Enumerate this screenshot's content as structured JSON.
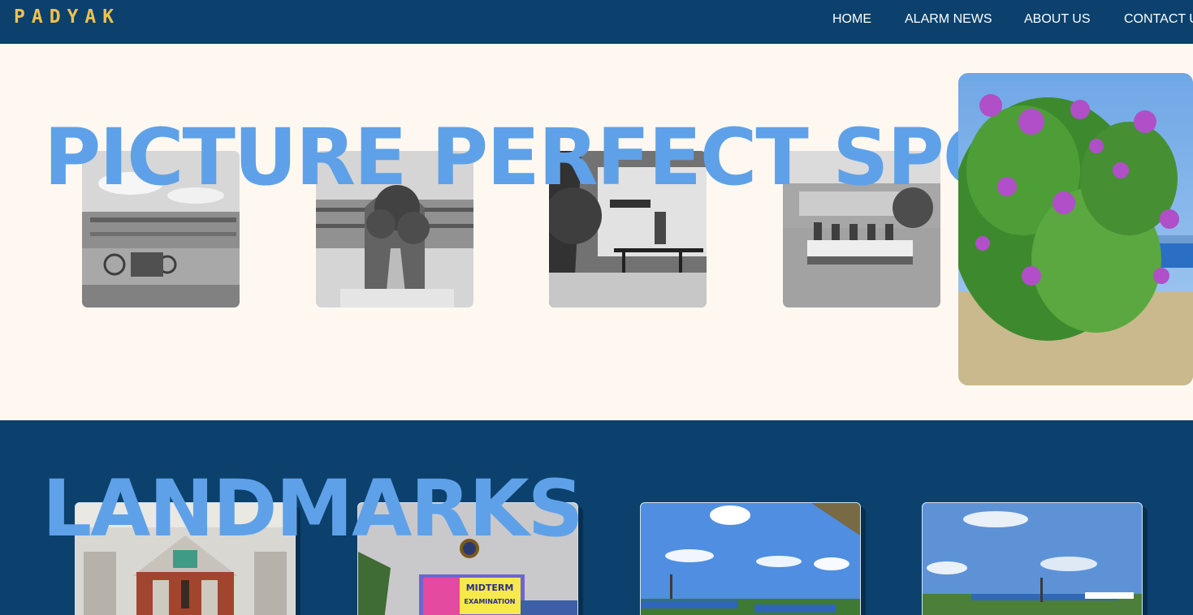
{
  "brand": {
    "logo_text": "PADYAK",
    "logo_color": "#f2c14e"
  },
  "nav": {
    "items": [
      {
        "label": "HOME"
      },
      {
        "label": "ALARM NEWS"
      },
      {
        "label": "ABOUT US"
      },
      {
        "label": "CONTACT US"
      }
    ]
  },
  "spots": {
    "heading": "PICTURE PERFECT SPOTS",
    "photo_count": 4
  },
  "landmarks": {
    "heading": "LANDMARKS",
    "card_count": 4,
    "midterm_text_line1": "MIDTERM",
    "midterm_text_line2": "EXAMINATION"
  },
  "colors": {
    "navy": "#0b416c",
    "cream": "#fff8f1",
    "heading_blue": "#5ea1e8",
    "accent_yellow": "#f2c14e"
  }
}
